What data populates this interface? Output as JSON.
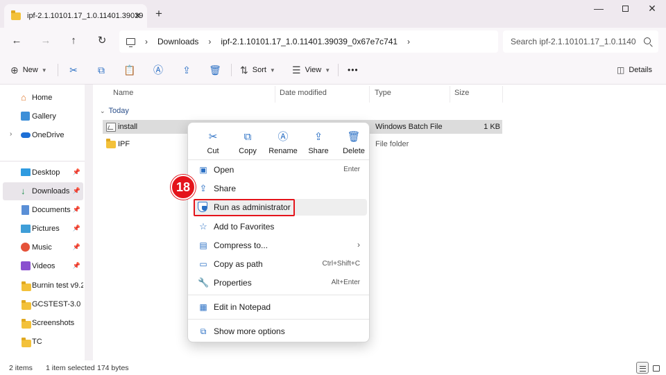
{
  "window": {
    "tab_title": "ipf-2.1.10101.17_1.0.11401.39039",
    "tab_close": "✕",
    "tab_add": "+",
    "controls": {
      "minimize": "—",
      "close": "✕"
    }
  },
  "nav": {
    "back": "←",
    "forward": "→",
    "up": "↑",
    "refresh": "↻",
    "breadcrumb": [
      "Downloads",
      "ipf-2.1.10101.17_1.0.11401.39039_0x67e7c741"
    ],
    "search_placeholder": "Search ipf-2.1.10101.17_1.0.1140\""
  },
  "commands": {
    "new_label": "New",
    "sort_label": "Sort",
    "view_label": "View",
    "more": "•••",
    "details_label": "Details"
  },
  "sidebar": {
    "items": [
      {
        "label": "Home",
        "icon": "home-icon"
      },
      {
        "label": "Gallery",
        "icon": "gallery-icon"
      },
      {
        "label": "OneDrive",
        "icon": "cloud-icon"
      },
      {
        "label": "Desktop",
        "icon": "desktop-icon"
      },
      {
        "label": "Downloads",
        "icon": "download-icon"
      },
      {
        "label": "Documents",
        "icon": "documents-icon"
      },
      {
        "label": "Pictures",
        "icon": "pictures-icon"
      },
      {
        "label": "Music",
        "icon": "music-icon"
      },
      {
        "label": "Videos",
        "icon": "videos-icon"
      },
      {
        "label": "Burnin test v9.2(",
        "icon": "folder-icon"
      },
      {
        "label": "GCSTEST-3.0",
        "icon": "folder-icon"
      },
      {
        "label": "Screenshots",
        "icon": "folder-icon"
      },
      {
        "label": "TC",
        "icon": "folder-icon"
      }
    ]
  },
  "list": {
    "columns": {
      "name": "Name",
      "date": "Date modified",
      "type": "Type",
      "size": "Size"
    },
    "group": "Today",
    "rows": [
      {
        "name": "install",
        "type": "Windows Batch File",
        "size": "1 KB"
      },
      {
        "name": "IPF",
        "type": "File folder",
        "size": ""
      }
    ]
  },
  "context_menu": {
    "quick_actions": [
      {
        "label": "Cut",
        "icon": "scissors-icon"
      },
      {
        "label": "Copy",
        "icon": "copy-icon"
      },
      {
        "label": "Rename",
        "icon": "rename-icon"
      },
      {
        "label": "Share",
        "icon": "share-icon"
      },
      {
        "label": "Delete",
        "icon": "trash-icon"
      }
    ],
    "items": [
      {
        "label": "Open",
        "shortcut": "Enter"
      },
      {
        "label": "Share",
        "shortcut": ""
      },
      {
        "label": "Run as administrator",
        "shortcut": ""
      },
      {
        "label": "Add to Favorites",
        "shortcut": ""
      },
      {
        "label": "Compress to...",
        "shortcut": ""
      },
      {
        "label": "Copy as path",
        "shortcut": "Ctrl+Shift+C"
      },
      {
        "label": "Properties",
        "shortcut": "Alt+Enter"
      },
      {
        "label": "Edit in Notepad",
        "shortcut": ""
      },
      {
        "label": "Show more options",
        "shortcut": ""
      }
    ]
  },
  "annotation": {
    "step": "18",
    "color": "#e4141b"
  },
  "status": {
    "count": "2 items",
    "selected": "1 item selected",
    "bytes": "174 bytes"
  },
  "colors": {
    "accent": "#2a6fc4",
    "folder": "#f3c13a",
    "highlight": "#e4141b"
  }
}
